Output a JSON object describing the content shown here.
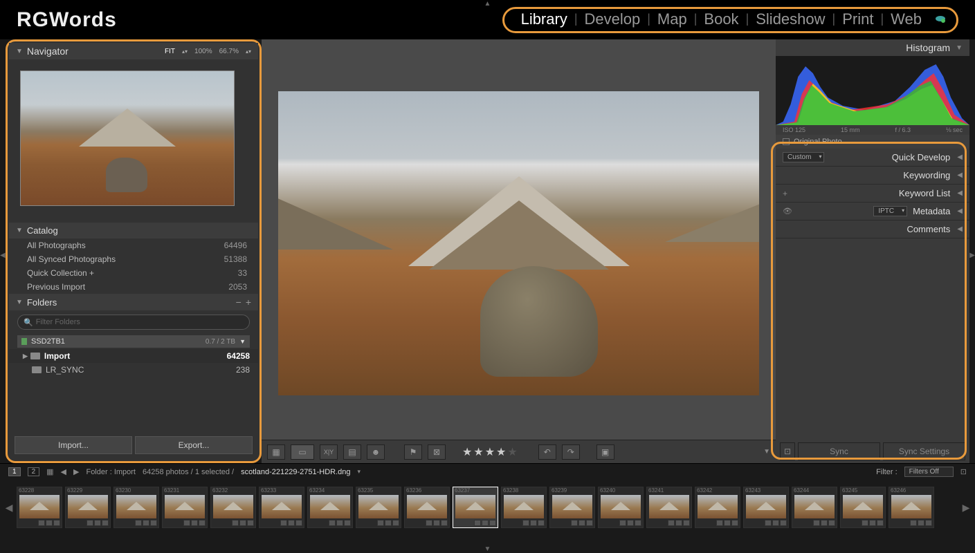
{
  "brand": "RGWords",
  "modules": [
    "Library",
    "Develop",
    "Map",
    "Book",
    "Slideshow",
    "Print",
    "Web"
  ],
  "active_module": "Library",
  "left": {
    "navigator": {
      "title": "Navigator",
      "fit": "FIT",
      "z1": "100%",
      "z2": "66.7%"
    },
    "catalog": {
      "title": "Catalog",
      "items": [
        {
          "label": "All Photographs",
          "count": "64496"
        },
        {
          "label": "All Synced Photographs",
          "count": "51388"
        },
        {
          "label": "Quick Collection  +",
          "count": "33"
        },
        {
          "label": "Previous Import",
          "count": "2053"
        }
      ]
    },
    "folders": {
      "title": "Folders",
      "filter_placeholder": "Filter Folders",
      "drive": {
        "name": "SSD2TB1",
        "size": "0.7 / 2 TB"
      },
      "items": [
        {
          "label": "Import",
          "count": "64258",
          "selected": true,
          "has_children": true
        },
        {
          "label": "LR_SYNC",
          "count": "238",
          "selected": false,
          "has_children": false
        }
      ]
    },
    "import_btn": "Import...",
    "export_btn": "Export..."
  },
  "toolbar": {
    "rating": 4
  },
  "right": {
    "histogram": "Histogram",
    "histo_info": {
      "iso": "ISO 125",
      "fl": "15 mm",
      "ap": "f / 6.3",
      "sh": "⅛ sec"
    },
    "original": "Original Photo",
    "quick_dev": {
      "preset": "Custom",
      "label": "Quick Develop"
    },
    "keywording": "Keywording",
    "keyword_list": "Keyword List",
    "metadata": {
      "preset": "IPTC",
      "label": "Metadata"
    },
    "comments": "Comments",
    "sync": "Sync",
    "sync_settings": "Sync Settings"
  },
  "secbar": {
    "monitors": [
      "1",
      "2"
    ],
    "crumb": "Folder : Import",
    "stats": "64258 photos / 1 selected /",
    "filename": "scotland-221229-2751-HDR.dng",
    "filter_label": "Filter :",
    "filter_value": "Filters Off"
  },
  "filmstrip": {
    "start": 63228,
    "count": 19,
    "selected": 63237,
    "rated": 63237,
    "rating_text": "★★★★"
  }
}
